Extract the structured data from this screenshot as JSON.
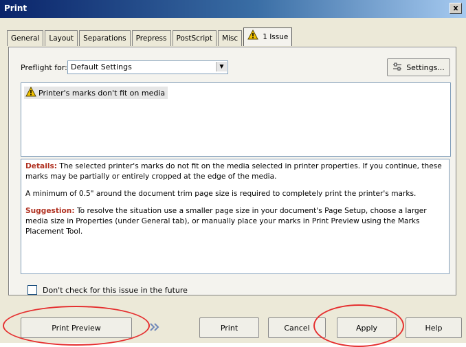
{
  "window": {
    "title": "Print",
    "close_label": "x"
  },
  "tabs": [
    {
      "label": "General"
    },
    {
      "label": "Layout"
    },
    {
      "label": "Separations"
    },
    {
      "label": "Prepress"
    },
    {
      "label": "PostScript"
    },
    {
      "label": "Misc"
    },
    {
      "label": "1 Issue",
      "active": true,
      "icon": "warning-icon"
    }
  ],
  "preflight": {
    "label": "Preflight for:",
    "selected": "Default Settings",
    "settings_label": "Settings...",
    "settings_icon": "settings-sliders-icon"
  },
  "issues": [
    {
      "label": "Printer's marks don't fit on media",
      "icon": "warning-icon"
    }
  ],
  "details": {
    "details_kw": "Details:",
    "details_text": " The selected printer's marks do not fit on the media selected in printer properties. If you continue, these marks may be partially or entirely cropped at the edge of the media.",
    "minimum_text": "A minimum of 0.5\" around the document trim page size is required to completely print the printer's marks.",
    "suggestion_kw": "Suggestion:",
    "suggestion_text": " To resolve the situation use a smaller page size in your document's Page Setup, choose a larger media size in Properties (under General tab), or manually place your marks in Print Preview using the Marks Placement Tool."
  },
  "checkbox": {
    "label": "Don't check for this issue in the future",
    "checked": false
  },
  "buttons": {
    "print_preview": "Print Preview",
    "print": "Print",
    "cancel": "Cancel",
    "apply": "Apply",
    "help": "Help"
  },
  "colors": {
    "keyword": "#b03020",
    "annotation": "#e53030",
    "warning": "#f2c200"
  }
}
